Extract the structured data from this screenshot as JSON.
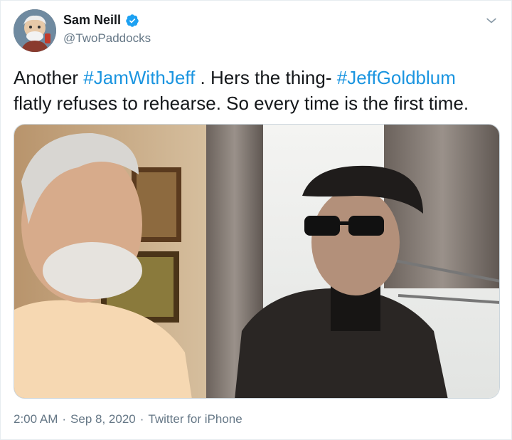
{
  "author": {
    "display_name": "Sam Neill",
    "handle": "@TwoPaddocks",
    "verified": true,
    "avatar": "profile-photo"
  },
  "header": {
    "menu_icon": "chevron-down-icon"
  },
  "tweet": {
    "line1_before": "Another ",
    "hashtag1": "#JamWithJeff",
    "line1_middle": " . Hers the thing- ",
    "hashtag2": "#JeffGoldblum",
    "line2": "flatly refuses to rehearse. So every time is the first time."
  },
  "media": {
    "type": "video-still",
    "icon": "video-thumbnail"
  },
  "meta": {
    "time": "2:00 AM",
    "separator1": "·",
    "date": "Sep 8, 2020",
    "separator2": "·",
    "source": "Twitter for iPhone"
  },
  "colors": {
    "link": "#1b95e0",
    "secondary": "#657786",
    "verified": "#1da1f2"
  }
}
